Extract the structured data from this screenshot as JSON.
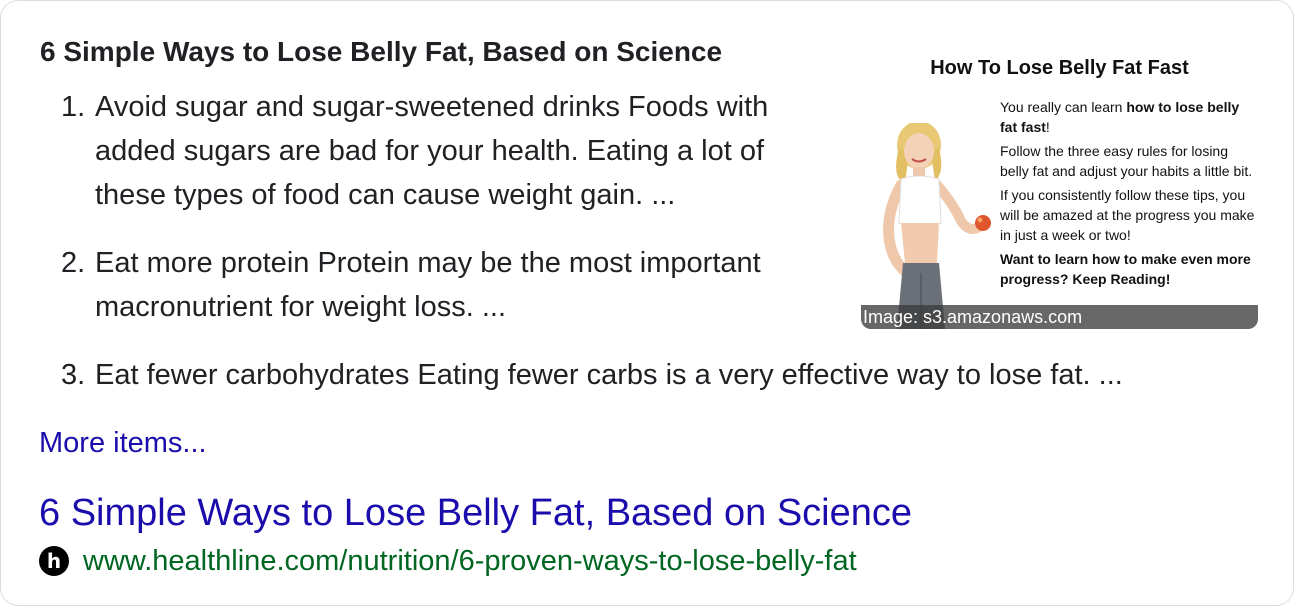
{
  "snippet": {
    "heading": "6 Simple Ways to Lose Belly Fat, Based on Science",
    "items": [
      {
        "number": "1.",
        "lines": [
          "Avoid sugar and sugar-sweetened drinks Foods with",
          "added sugars are bad for your health. Eating a lot of",
          "these types of food can cause weight gain. ..."
        ]
      },
      {
        "number": "2.",
        "lines": [
          "Eat more protein Protein may be the most important",
          "macronutrient for weight loss. ..."
        ]
      },
      {
        "number": "3.",
        "lines": [
          "Eat fewer carbohydrates Eating fewer carbs is a very effective way to lose fat. ..."
        ]
      }
    ],
    "more_label": "More items..."
  },
  "image": {
    "title": "How To Lose Belly Fat Fast",
    "para1_pre": "You really can learn ",
    "para1_bold": "how to lose belly fat fast",
    "para1_post": "!",
    "para2": "Follow the three easy rules for losing belly fat and adjust your habits a little bit.",
    "para3": "If you consistently follow these tips, you will be amazed at the progress you make in just a week or two!",
    "para4": "Want to learn how to make even more progress?  Keep Reading!",
    "caption": "Image: s3.amazonaws.com"
  },
  "result": {
    "title": "6 Simple Ways to Lose Belly Fat, Based on Science",
    "favicon_letter": "h",
    "url": "www.healthline.com/nutrition/6-proven-ways-to-lose-belly-fat"
  },
  "colors": {
    "link": "#1a0dab",
    "url": "#006621",
    "text": "#202124"
  }
}
